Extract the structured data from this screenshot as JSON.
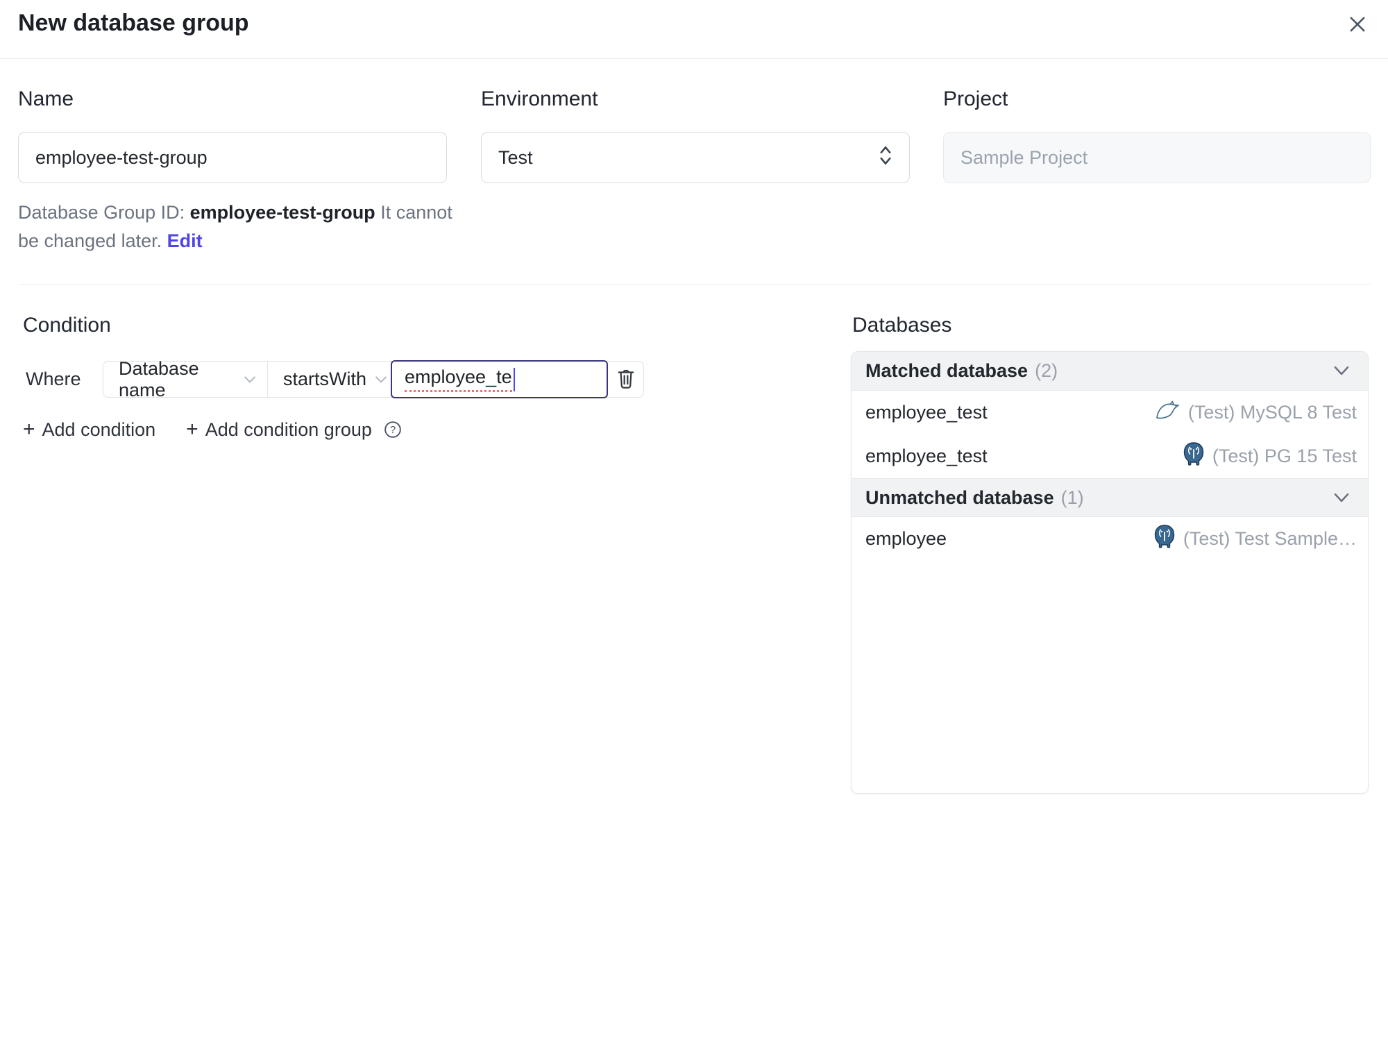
{
  "dialog": {
    "title": "New database group"
  },
  "form": {
    "name": {
      "label": "Name",
      "value": "employee-test-group"
    },
    "environment": {
      "label": "Environment",
      "value": "Test"
    },
    "project": {
      "label": "Project",
      "value": "Sample Project"
    },
    "group_id_note": {
      "prefix": "Database Group ID: ",
      "id": "employee-test-group",
      "suffix": " It cannot be changed later. ",
      "edit_label": "Edit"
    }
  },
  "condition": {
    "heading": "Condition",
    "where_label": "Where",
    "field": "Database name",
    "operator": "startsWith",
    "value": "employee_te",
    "plus_glyph": "+",
    "add_condition_label": "Add condition",
    "add_condition_group_label": "Add condition group"
  },
  "databases": {
    "heading": "Databases",
    "sections": [
      {
        "title": "Matched database",
        "count": "(2)",
        "rows": [
          {
            "name": "employee_test",
            "instance": "(Test) MySQL 8 Test",
            "engine": "mysql"
          },
          {
            "name": "employee_test",
            "instance": "(Test) PG 15 Test",
            "engine": "postgres"
          }
        ]
      },
      {
        "title": "Unmatched database",
        "count": "(1)",
        "rows": [
          {
            "name": "employee",
            "instance": "(Test) Test Sample…",
            "engine": "postgres"
          }
        ]
      }
    ]
  },
  "colors": {
    "accent": "#4f46e5",
    "focused_input_border": "#3a347e",
    "spellcheck_underline": "#ee7070",
    "section_header_bg": "#f1f2f4",
    "muted_text": "#9aa1ab",
    "note_text": "#6b7280",
    "border": "#e5e7eb",
    "mysql_icon_color": "#44708e",
    "postgres_icon_color": "#38678f"
  }
}
